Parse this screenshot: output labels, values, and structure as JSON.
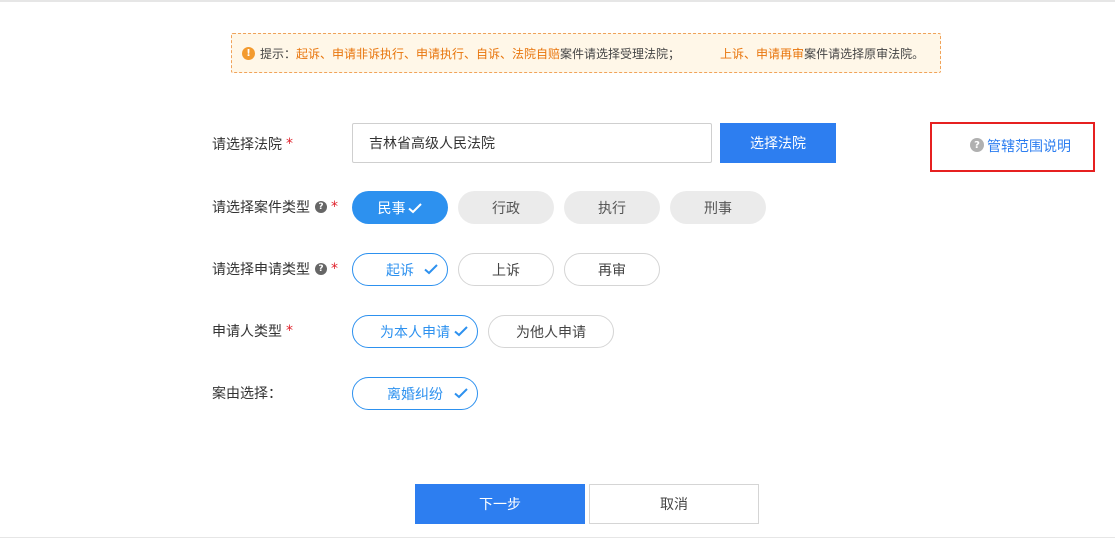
{
  "notice": {
    "prefix": "提示：",
    "orange1": "起诉、申请非诉执行、申请执行、自诉、法院自赔",
    "text1": " 案件请选择受理法院；",
    "orange2": "上诉、申请再审",
    "text2": " 案件请选择原审法院。"
  },
  "court": {
    "label": "请选择法院",
    "required": "*",
    "value": "吉林省高级人民法院",
    "select_button": "选择法院"
  },
  "scope": {
    "link": "管辖范围说明"
  },
  "case_type": {
    "label": "请选择案件类型",
    "required": "*",
    "options": [
      "民事",
      "行政",
      "执行",
      "刑事"
    ]
  },
  "apply_type": {
    "label": "请选择申请类型",
    "required": "*",
    "options": [
      "起诉",
      "上诉",
      "再审"
    ]
  },
  "applicant_type": {
    "label": "申请人类型",
    "required": "*",
    "options": [
      "为本人申请",
      "为他人申请"
    ]
  },
  "cause": {
    "label": "案由选择：",
    "value": "离婚纠纷"
  },
  "footer": {
    "next": "下一步",
    "cancel": "取消"
  },
  "colors": {
    "primary": "#2d7ef0",
    "pill_active": "#2d91ef",
    "warning": "#e8750c",
    "highlight_box": "#e62020"
  }
}
